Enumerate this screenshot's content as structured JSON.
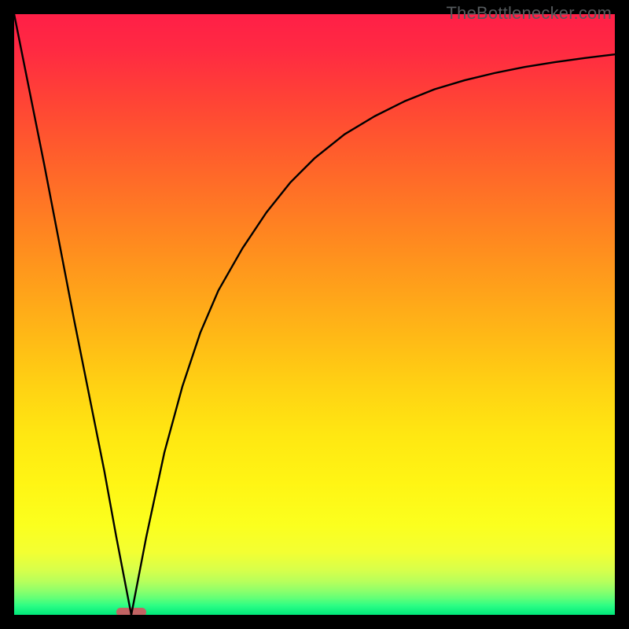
{
  "watermark": "TheBottlenecker.com",
  "chart_data": {
    "type": "line",
    "title": "",
    "xlabel": "",
    "ylabel": "",
    "xlim": [
      0,
      100
    ],
    "ylim": [
      0,
      100
    ],
    "grid": false,
    "legend": false,
    "background": "red-yellow-green-vertical-gradient",
    "marker": {
      "x": 19.5,
      "y": 0,
      "width_x": 5,
      "color": "#c26464",
      "shape": "rounded-bar"
    },
    "series": [
      {
        "name": "bottleneck-curve",
        "x": [
          0,
          5,
          10,
          15,
          17,
          19.5,
          22,
          25,
          28,
          31,
          34,
          38,
          42,
          46,
          50,
          55,
          60,
          65,
          70,
          75,
          80,
          85,
          90,
          95,
          100
        ],
        "values": [
          100,
          75,
          49,
          24,
          13,
          0,
          13,
          27,
          38,
          47,
          54,
          61,
          67,
          72,
          76,
          80,
          83,
          85.5,
          87.5,
          89,
          90.2,
          91.2,
          92,
          92.7,
          93.3
        ]
      }
    ]
  },
  "gradient_stops": [
    {
      "offset": 0.0,
      "color": "#ff1f47"
    },
    {
      "offset": 0.06,
      "color": "#ff2a42"
    },
    {
      "offset": 0.14,
      "color": "#ff4236"
    },
    {
      "offset": 0.22,
      "color": "#ff5a2d"
    },
    {
      "offset": 0.3,
      "color": "#ff7226"
    },
    {
      "offset": 0.38,
      "color": "#ff8a1f"
    },
    {
      "offset": 0.46,
      "color": "#ffa21a"
    },
    {
      "offset": 0.54,
      "color": "#ffba16"
    },
    {
      "offset": 0.62,
      "color": "#ffd213"
    },
    {
      "offset": 0.7,
      "color": "#ffe712"
    },
    {
      "offset": 0.78,
      "color": "#fff514"
    },
    {
      "offset": 0.85,
      "color": "#fbff1e"
    },
    {
      "offset": 0.895,
      "color": "#f3ff32"
    },
    {
      "offset": 0.925,
      "color": "#d8ff4a"
    },
    {
      "offset": 0.945,
      "color": "#b6ff5c"
    },
    {
      "offset": 0.96,
      "color": "#8dff6b"
    },
    {
      "offset": 0.973,
      "color": "#5fff78"
    },
    {
      "offset": 0.985,
      "color": "#2bfd84"
    },
    {
      "offset": 1.0,
      "color": "#00e87b"
    }
  ]
}
